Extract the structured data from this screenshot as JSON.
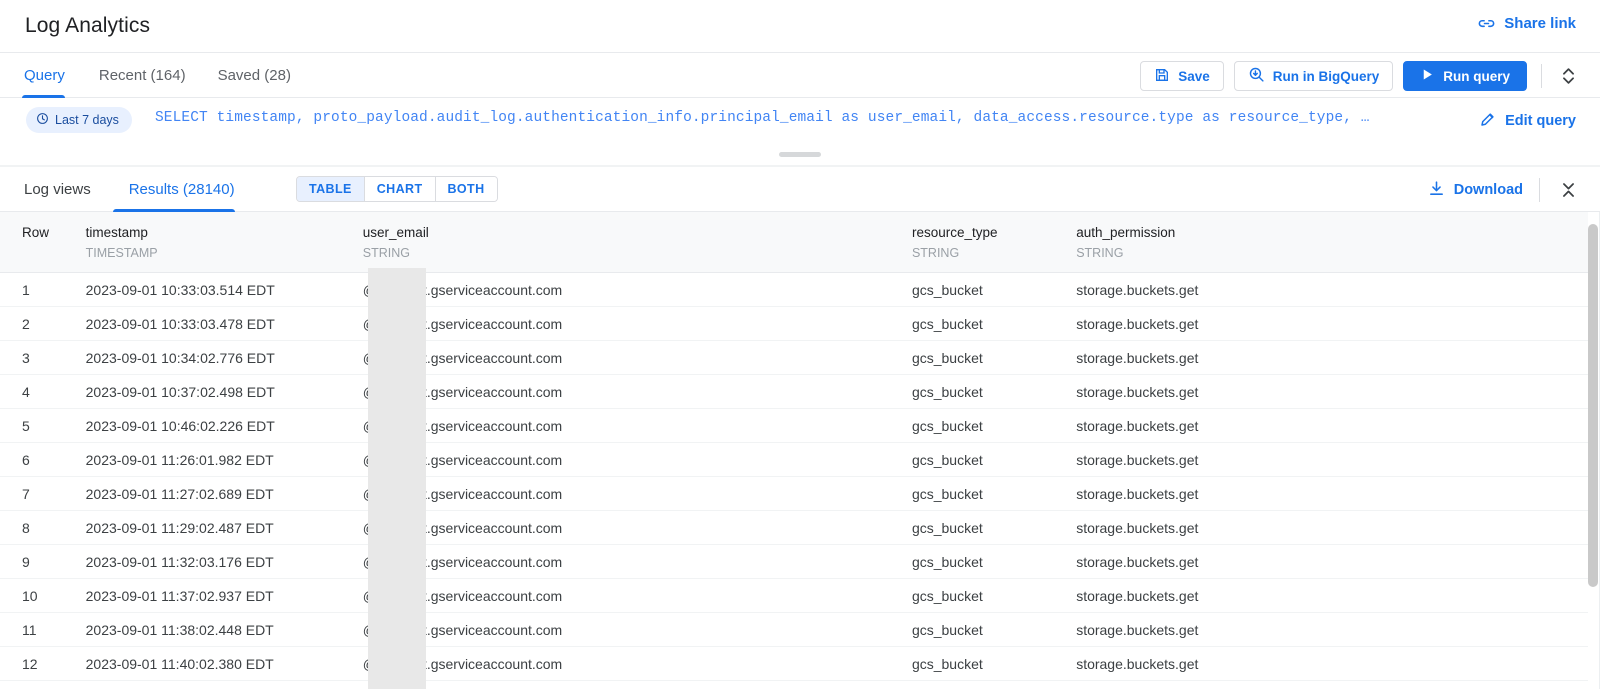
{
  "header": {
    "title": "Log Analytics",
    "share_link_label": "Share link",
    "share_link_icon": "link-icon"
  },
  "tabbar": {
    "tabs": [
      {
        "label": "Query",
        "active": true
      },
      {
        "label": "Recent (164)",
        "active": false
      },
      {
        "label": "Saved (28)",
        "active": false
      }
    ],
    "actions": {
      "save_label": "Save",
      "save_icon": "save-disk-icon",
      "run_bigquery_label": "Run in BigQuery",
      "run_bigquery_icon": "bigquery-magnifier-icon",
      "run_query_label": "Run query",
      "run_query_icon": "play-triangle-icon",
      "collapse_icon": "expand-collapse-chevrons-icon"
    }
  },
  "query": {
    "time_range_chip": "Last 7 days",
    "time_range_icon": "clock-icon",
    "sql": "SELECT timestamp, proto_payload.audit_log.authentication_info.principal_email as user_email, data_access.resource.type as resource_type, …",
    "edit_label": "Edit query",
    "edit_icon": "pencil-icon"
  },
  "results": {
    "tabs": [
      {
        "label": "Log views",
        "active": false
      },
      {
        "label": "Results (28140)",
        "active": true
      }
    ],
    "view_modes": [
      {
        "label": "TABLE",
        "active": true
      },
      {
        "label": "CHART",
        "active": false
      },
      {
        "label": "BOTH",
        "active": false
      }
    ],
    "download_label": "Download",
    "download_icon": "download-arrow-icon",
    "collapse_icon": "collapse-chevrons-icon"
  },
  "table": {
    "columns": [
      {
        "name": "Row",
        "type": ""
      },
      {
        "name": "timestamp",
        "type": "TIMESTAMP"
      },
      {
        "name": "user_email",
        "type": "STRING"
      },
      {
        "name": "resource_type",
        "type": "STRING"
      },
      {
        "name": "auth_permission",
        "type": "STRING"
      }
    ],
    "rows": [
      {
        "row": "1",
        "timestamp": "2023-09-01 10:33:03.514 EDT",
        "user_email": "@appspot.gserviceaccount.com",
        "resource_type": "gcs_bucket",
        "auth_permission": "storage.buckets.get"
      },
      {
        "row": "2",
        "timestamp": "2023-09-01 10:33:03.478 EDT",
        "user_email": "@appspot.gserviceaccount.com",
        "resource_type": "gcs_bucket",
        "auth_permission": "storage.buckets.get"
      },
      {
        "row": "3",
        "timestamp": "2023-09-01 10:34:02.776 EDT",
        "user_email": "@appspot.gserviceaccount.com",
        "resource_type": "gcs_bucket",
        "auth_permission": "storage.buckets.get"
      },
      {
        "row": "4",
        "timestamp": "2023-09-01 10:37:02.498 EDT",
        "user_email": "@appspot.gserviceaccount.com",
        "resource_type": "gcs_bucket",
        "auth_permission": "storage.buckets.get"
      },
      {
        "row": "5",
        "timestamp": "2023-09-01 10:46:02.226 EDT",
        "user_email": "@appspot.gserviceaccount.com",
        "resource_type": "gcs_bucket",
        "auth_permission": "storage.buckets.get"
      },
      {
        "row": "6",
        "timestamp": "2023-09-01 11:26:01.982 EDT",
        "user_email": "@appspot.gserviceaccount.com",
        "resource_type": "gcs_bucket",
        "auth_permission": "storage.buckets.get"
      },
      {
        "row": "7",
        "timestamp": "2023-09-01 11:27:02.689 EDT",
        "user_email": "@appspot.gserviceaccount.com",
        "resource_type": "gcs_bucket",
        "auth_permission": "storage.buckets.get"
      },
      {
        "row": "8",
        "timestamp": "2023-09-01 11:29:02.487 EDT",
        "user_email": "@appspot.gserviceaccount.com",
        "resource_type": "gcs_bucket",
        "auth_permission": "storage.buckets.get"
      },
      {
        "row": "9",
        "timestamp": "2023-09-01 11:32:03.176 EDT",
        "user_email": "@appspot.gserviceaccount.com",
        "resource_type": "gcs_bucket",
        "auth_permission": "storage.buckets.get"
      },
      {
        "row": "10",
        "timestamp": "2023-09-01 11:37:02.937 EDT",
        "user_email": "@appspot.gserviceaccount.com",
        "resource_type": "gcs_bucket",
        "auth_permission": "storage.buckets.get"
      },
      {
        "row": "11",
        "timestamp": "2023-09-01 11:38:02.448 EDT",
        "user_email": "@appspot.gserviceaccount.com",
        "resource_type": "gcs_bucket",
        "auth_permission": "storage.buckets.get"
      },
      {
        "row": "12",
        "timestamp": "2023-09-01 11:40:02.380 EDT",
        "user_email": "@appspot.gserviceaccount.com",
        "resource_type": "gcs_bucket",
        "auth_permission": "storage.buckets.get"
      }
    ]
  },
  "colors": {
    "accent": "#1a73e8",
    "chip_bg": "#e8f0fe",
    "header_bg": "#f8f9fa",
    "sql_text": "#4285f4",
    "redaction": "#e8e8e8"
  }
}
